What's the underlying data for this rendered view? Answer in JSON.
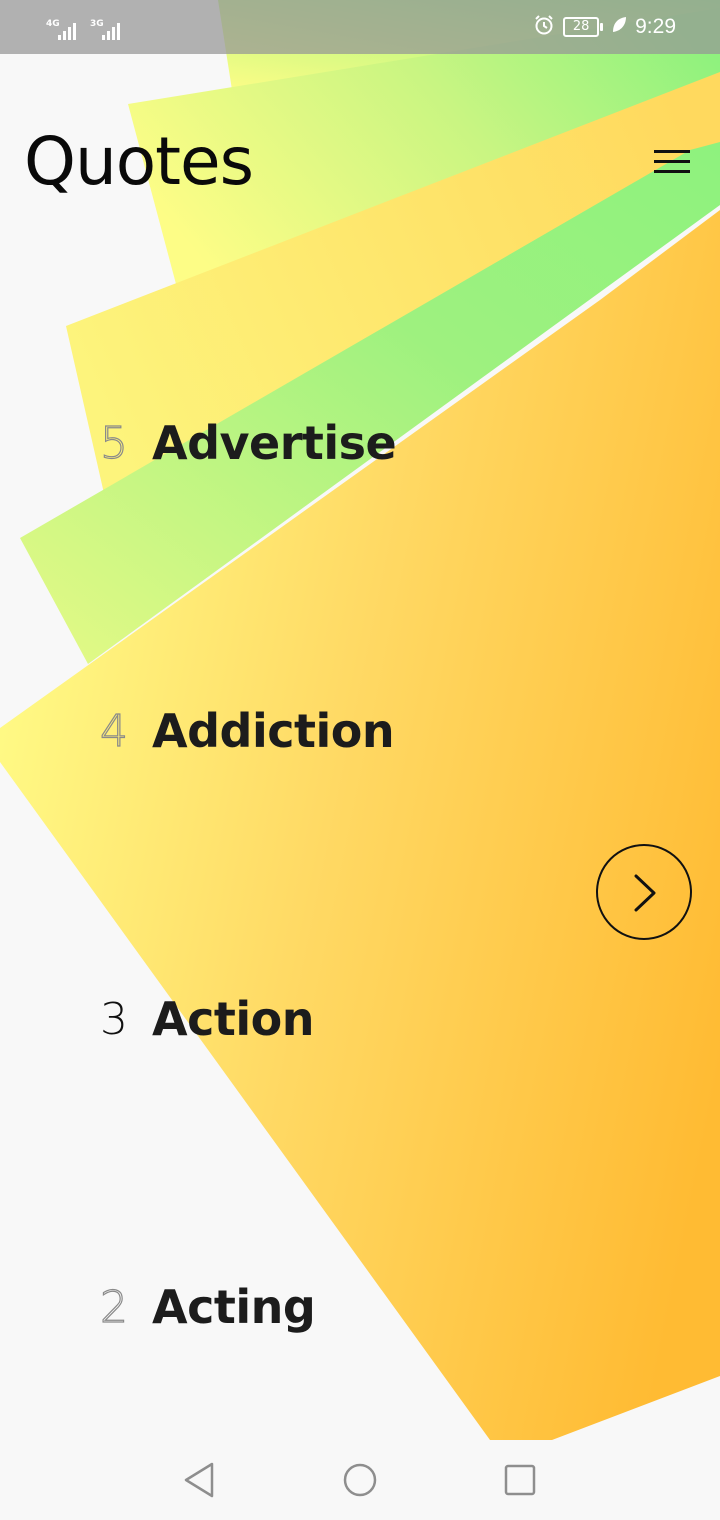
{
  "status_bar": {
    "signal_1_network": "4G",
    "signal_2_network": "3G",
    "battery_level": "28",
    "time": "9:29",
    "icons": [
      "alarm-icon",
      "battery-icon",
      "leaf-icon"
    ]
  },
  "header": {
    "title": "Quotes",
    "menu_icon": "hamburger-menu-icon"
  },
  "categories": [
    {
      "number": "5",
      "label": "Advertise",
      "style": "outline"
    },
    {
      "number": "4",
      "label": "Addiction",
      "style": "outline"
    },
    {
      "number": "3",
      "label": "Action",
      "style": "solid"
    },
    {
      "number": "2",
      "label": "Acting",
      "style": "outline"
    }
  ],
  "next_button": {
    "icon": "chevron-right-icon"
  },
  "nav_bar": {
    "icons": [
      "back-triangle-icon",
      "home-circle-icon",
      "recents-square-icon"
    ]
  },
  "colors": {
    "gradient_yellow": "#fdfd86",
    "gradient_green": "#8ff27e",
    "gradient_orange": "#ffbc36",
    "text_dark": "#111111",
    "background": "#f8f8f8"
  }
}
